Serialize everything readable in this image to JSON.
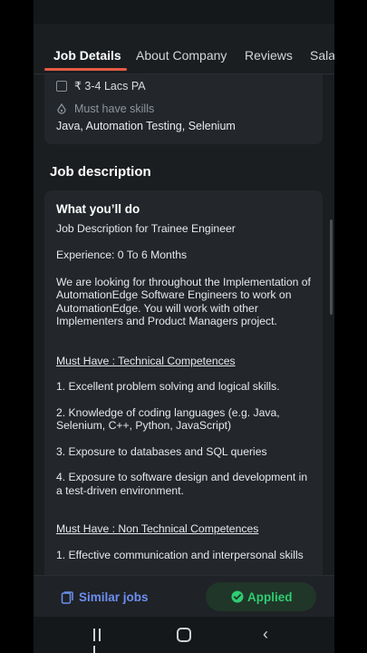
{
  "tabs": [
    {
      "label": "Job Details",
      "active": true
    },
    {
      "label": "About Company",
      "active": false
    },
    {
      "label": "Reviews",
      "active": false
    },
    {
      "label": "Sala",
      "active": false
    }
  ],
  "summary": {
    "salary": "₹ 3-4 Lacs PA",
    "skills_heading": "Must have skills",
    "skills": "Java, Automation Testing, Selenium"
  },
  "description": {
    "section_title": "Job description",
    "heading": "What you’ll do",
    "line1": "Job Description for Trainee Engineer",
    "experience": "Experience:  0 To 6 Months",
    "intro": "We are looking for throughout the Implementation of AutomationEdge Software Engineers to work on AutomationEdge. You will work with other Implementers and Product Managers project.",
    "tech_heading": "Must Have : Technical Competences ",
    "tech_1": "1. Excellent problem solving and logical skills.",
    "tech_2": "2. Knowledge of coding languages (e.g. Java, Selenium, C++, Python, JavaScript)",
    "tech_3": "3. Exposure to databases and SQL queries",
    "tech_4": "4. Exposure to software design and development in a test-driven environment.",
    "nontech_heading": "Must Have : Non Technical Competences ",
    "nontech_1": "1.  Effective communication and interpersonal skills"
  },
  "bottom": {
    "similar_jobs": "Similar jobs",
    "applied": "Applied"
  },
  "colors": {
    "accent": "#e65a44",
    "link": "#6c8ff0",
    "applied": "#2ecc71",
    "background": "#1b1e21",
    "card": "#23272b"
  },
  "icons": {
    "salary": "wallet-icon",
    "skills": "skill-drop-icon",
    "similar": "similar-jobs-icon",
    "applied": "check-circle-icon"
  }
}
